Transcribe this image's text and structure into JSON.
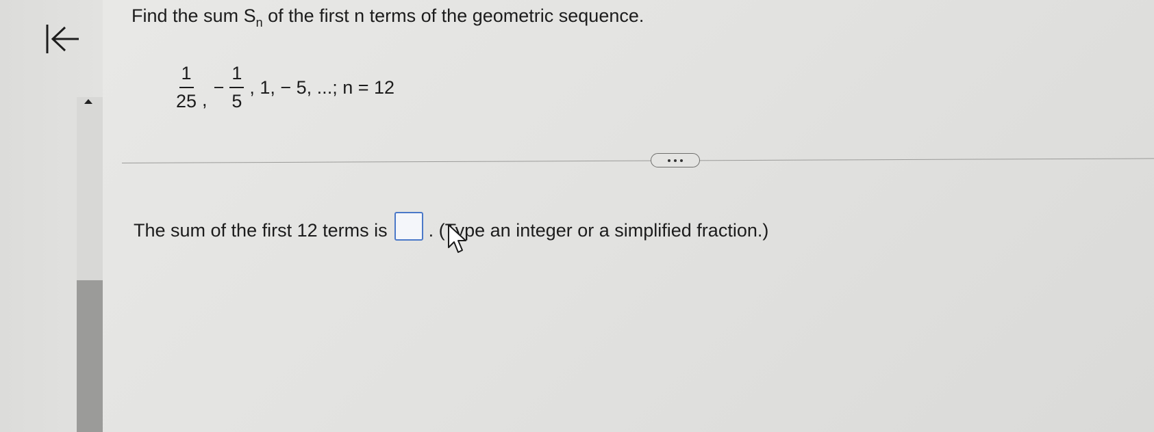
{
  "question": {
    "prefix": "Find the sum S",
    "subscript": "n",
    "suffix": " of the first n terms of the geometric sequence."
  },
  "sequence": {
    "first_num": "1",
    "first_den": "25",
    "sep1": ",",
    "minus": "−",
    "second_num": "1",
    "second_den": "5",
    "tail": ", 1, − 5, ...; n = 12"
  },
  "answer": {
    "prefix": "The sum of the first 12 terms is",
    "value": "",
    "hint": ". (Type an integer or a simplified fraction.)"
  },
  "icons": {
    "back": "back-to-start-icon",
    "more": "more-options-icon",
    "cursor": "mouse-pointer-icon"
  },
  "colors": {
    "input_border": "#4a78c8",
    "scroll_thumb": "#9b9b99"
  }
}
